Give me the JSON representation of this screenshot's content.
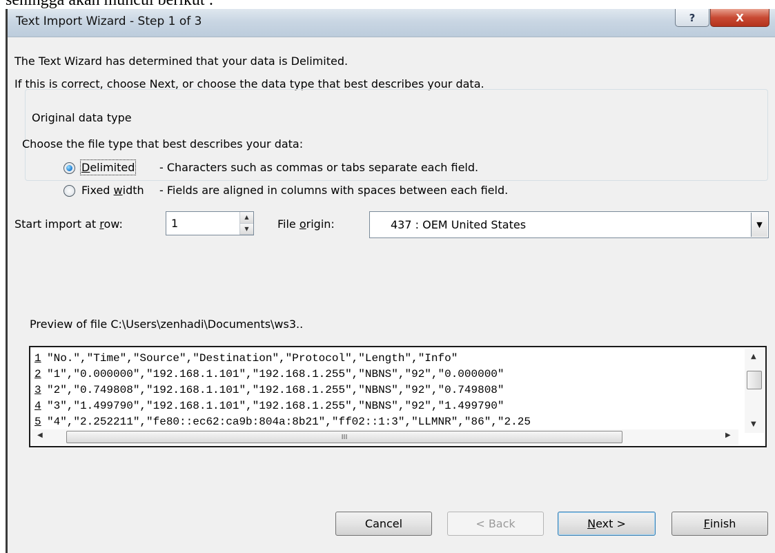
{
  "caption_above": "sehingga akan muncul berikut :",
  "window": {
    "title": "Text Import Wizard - Step 1 of 3",
    "help_label": "?",
    "close_label": "X"
  },
  "intro": {
    "line1": "The Text Wizard has determined that your data is Delimited.",
    "line2": "If this is correct, choose Next, or choose the data type that best describes your data."
  },
  "original_data_type": {
    "legend": "Original data type",
    "prompt": "Choose the file type that best describes your data:",
    "options": [
      {
        "label_pre": "",
        "label_u": "D",
        "label_post": "elimited",
        "desc": "- Characters such as commas or tabs separate each field.",
        "selected": true
      },
      {
        "label_pre": "Fixed ",
        "label_u": "w",
        "label_post": "idth",
        "desc": "- Fields are aligned in columns with spaces between each field.",
        "selected": false
      }
    ]
  },
  "start_row": {
    "label_pre": "Start import at ",
    "label_u": "r",
    "label_post": "ow:",
    "value": "1"
  },
  "file_origin": {
    "label_pre": "File ",
    "label_u": "o",
    "label_post": "rigin:",
    "value": "437 : OEM United States"
  },
  "preview": {
    "label": "Preview of file C:\\Users\\zenhadi\\Documents\\ws3..",
    "lines": [
      {
        "num": "1",
        "text": "\"No.\",\"Time\",\"Source\",\"Destination\",\"Protocol\",\"Length\",\"Info\""
      },
      {
        "num": "2",
        "text": "\"1\",\"0.000000\",\"192.168.1.101\",\"192.168.1.255\",\"NBNS\",\"92\",\"0.000000\""
      },
      {
        "num": "3",
        "text": "\"2\",\"0.749808\",\"192.168.1.101\",\"192.168.1.255\",\"NBNS\",\"92\",\"0.749808\""
      },
      {
        "num": "4",
        "text": "\"3\",\"1.499790\",\"192.168.1.101\",\"192.168.1.255\",\"NBNS\",\"92\",\"1.499790\""
      },
      {
        "num": "5",
        "text": "\"4\",\"2.252211\",\"fe80::ec62:ca9b:804a:8b21\",\"ff02::1:3\",\"LLMNR\",\"86\",\"2.25"
      }
    ],
    "hscroll_thumb_grip": "III"
  },
  "buttons": {
    "cancel": "Cancel",
    "back": "< Back",
    "next_u": "N",
    "next_rest": "ext >",
    "finish_u": "F",
    "finish_rest": "inish"
  }
}
